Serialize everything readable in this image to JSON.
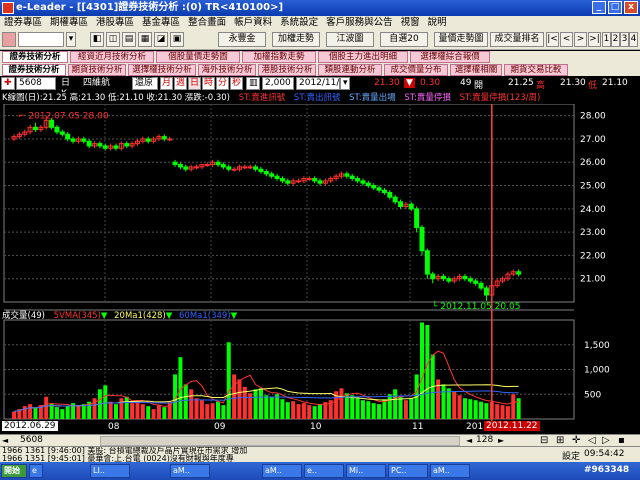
{
  "window": {
    "title": "e-Leader - [[4301]證券技術分析 :(0) TR<410100>]",
    "controls": [
      "_",
      "□",
      "x"
    ]
  },
  "menu": [
    "證券專區",
    "期權專區",
    "港股專區",
    "基金專區",
    "整合畫面",
    "帳戶資料",
    "系統設定",
    "客戶服務與公告",
    "視窗",
    "說明"
  ],
  "toolbar": {
    "buttons": [
      "永豐金",
      "加權走勢",
      "江波圖",
      "自選20",
      "量價走勢圖",
      "成交量排名"
    ],
    "nav": [
      "|<",
      "<",
      ">",
      ">|",
      "1",
      "2",
      "3",
      "4"
    ]
  },
  "tabs_row1": [
    "證券技術分析",
    "經資近月技術分析",
    "個股量價走勢圖",
    "加權指數走勢",
    "個股主力進出明細",
    "選擇權綜合報價"
  ],
  "tabs_row2": [
    "證券技術分析",
    "期貨技術分析",
    "選擇權技術分析",
    "海外技術分析",
    "港股技術分析",
    "類股連動分析",
    "成交價量分布",
    "選擇權相關",
    "期貨交易比較"
  ],
  "chartbar": {
    "symbol": "5608",
    "name": "四維航",
    "period_label": "日K",
    "buttons": [
      "還原",
      "月",
      "週",
      "日",
      "時",
      "分",
      "秒"
    ],
    "count": "2,000",
    "date": "2012/11/29",
    "quote": {
      "open_label": "開",
      "open_value": "21.30",
      "change_value": "0.30",
      "volume_value": "49",
      "high_label": "開",
      "high_value": "21.25",
      "low_label": "高",
      "low_value": "21.30",
      "close_label": "低",
      "close_value": "21.10"
    }
  },
  "infobar": {
    "prices": "K線圖(日):21.25 高:21.30 低:21.10 收:21.30 漲跌:-0.30)",
    "labels": [
      {
        "text": "ST:賣進訊號",
        "color": "#ff3333"
      },
      {
        "text": "ST:賣出訊號",
        "color": "#3366ff"
      },
      {
        "text": "ST:賣量出場",
        "color": "#66aaff"
      },
      {
        "text": "ST:賣量停損",
        "color": "#ff66ff"
      },
      {
        "text": "ST:賣量停損(123/周)",
        "color": "#ff3333"
      }
    ]
  },
  "annotations": {
    "high": "2012.07.05  28.00",
    "low": "2012.11.05  20.05"
  },
  "volume": {
    "label": "成交量(49)",
    "ma": [
      {
        "text": "5VMA(345)",
        "color": "#ff3333"
      },
      {
        "text": "20Ma1(428)",
        "color": "#ffff66"
      },
      {
        "text": "60Ma1(349)",
        "color": "#3366ff"
      }
    ]
  },
  "dates": {
    "start": "2012.06.29",
    "months": [
      "08",
      "09",
      "10",
      "11",
      "201"
    ],
    "cursor": "2012.11.22"
  },
  "scroll": {
    "symbol": "5608",
    "zoom": "128"
  },
  "status": {
    "quote_lines": [
      "1966 1361 [9:46:00] 美股: 台積電總裁及戶晶片實現在市需求 增加",
      "1966 1351 [9:45:01] 豪華會:上.台電 (0024)沒有財報與年度專"
    ],
    "setting": "設定",
    "time": "09:54:42",
    "code": "#963348"
  },
  "taskbar": [
    "開始",
    "e",
    "LI..",
    "aM..",
    "aM..",
    "e..",
    "Mi..",
    "PC..",
    "aM.."
  ],
  "chart_data": {
    "type": "candlestick",
    "yticks": [
      21.0,
      22.0,
      23.0,
      24.0,
      25.0,
      26.0,
      27.0,
      28.0
    ],
    "volume_ticks": [
      500,
      1000,
      1500
    ],
    "colors": {
      "up": "#ff3030",
      "down": "#00ff00",
      "grid": "#808080"
    },
    "ohlc": [
      [
        27.0,
        27.2,
        26.9,
        27.1
      ],
      [
        27.1,
        27.3,
        27.0,
        27.2
      ],
      [
        27.2,
        27.4,
        27.1,
        27.3
      ],
      [
        27.3,
        27.6,
        27.2,
        27.5
      ],
      [
        27.5,
        27.7,
        27.3,
        27.4
      ],
      [
        27.4,
        27.6,
        27.3,
        27.5
      ],
      [
        27.5,
        28.0,
        27.4,
        27.8
      ],
      [
        27.8,
        27.9,
        27.4,
        27.5
      ],
      [
        27.5,
        27.6,
        27.2,
        27.3
      ],
      [
        27.3,
        27.4,
        27.1,
        27.2
      ],
      [
        27.2,
        27.3,
        26.9,
        27.0
      ],
      [
        27.0,
        27.1,
        26.8,
        26.9
      ],
      [
        26.9,
        27.1,
        26.8,
        27.0
      ],
      [
        27.0,
        27.1,
        26.8,
        26.9
      ],
      [
        26.9,
        27.0,
        26.6,
        26.7
      ],
      [
        26.7,
        26.9,
        26.6,
        26.8
      ],
      [
        26.8,
        26.9,
        26.6,
        26.7
      ],
      [
        26.7,
        26.8,
        26.5,
        26.6
      ],
      [
        26.6,
        26.8,
        26.5,
        26.7
      ],
      [
        26.7,
        26.8,
        26.5,
        26.6
      ],
      [
        26.6,
        26.9,
        26.5,
        26.8
      ],
      [
        26.8,
        26.9,
        26.6,
        26.7
      ],
      [
        26.7,
        26.9,
        26.6,
        26.8
      ],
      [
        26.8,
        27.0,
        26.7,
        26.9
      ],
      [
        26.9,
        27.1,
        26.8,
        27.0
      ],
      [
        27.0,
        27.1,
        26.8,
        26.9
      ],
      [
        26.9,
        27.1,
        26.8,
        27.0
      ],
      [
        27.0,
        27.2,
        26.9,
        27.1
      ],
      [
        27.1,
        27.2,
        26.9,
        27.0
      ],
      [
        27.0,
        27.1,
        26.9,
        27.0
      ],
      [
        26.0,
        26.1,
        25.8,
        25.9
      ],
      [
        25.9,
        26.0,
        25.7,
        25.8
      ],
      [
        25.8,
        25.9,
        25.6,
        25.7
      ],
      [
        25.7,
        25.9,
        25.6,
        25.8
      ],
      [
        25.8,
        25.9,
        25.7,
        25.8
      ],
      [
        25.8,
        25.9,
        25.7,
        25.9
      ],
      [
        25.9,
        26.0,
        25.8,
        25.9
      ],
      [
        25.9,
        26.1,
        25.8,
        26.0
      ],
      [
        26.0,
        26.1,
        25.8,
        25.9
      ],
      [
        25.9,
        26.0,
        25.7,
        25.8
      ],
      [
        25.8,
        25.9,
        25.6,
        25.7
      ],
      [
        25.7,
        25.8,
        25.6,
        25.7
      ],
      [
        25.7,
        25.9,
        25.6,
        25.8
      ],
      [
        25.8,
        25.9,
        25.7,
        25.8
      ],
      [
        25.8,
        25.9,
        25.7,
        25.8
      ],
      [
        25.8,
        25.9,
        25.6,
        25.7
      ],
      [
        25.7,
        25.8,
        25.5,
        25.6
      ],
      [
        25.6,
        25.7,
        25.4,
        25.5
      ],
      [
        25.5,
        25.6,
        25.3,
        25.4
      ],
      [
        25.4,
        25.5,
        25.2,
        25.3
      ],
      [
        25.3,
        25.4,
        25.1,
        25.2
      ],
      [
        25.2,
        25.3,
        25.0,
        25.1
      ],
      [
        25.1,
        25.3,
        25.0,
        25.2
      ],
      [
        25.2,
        25.3,
        25.1,
        25.2
      ],
      [
        25.2,
        25.4,
        25.1,
        25.3
      ],
      [
        25.3,
        25.4,
        25.2,
        25.3
      ],
      [
        25.3,
        25.4,
        25.1,
        25.2
      ],
      [
        25.2,
        25.3,
        25.0,
        25.1
      ],
      [
        25.1,
        25.3,
        25.0,
        25.2
      ],
      [
        25.2,
        25.4,
        25.1,
        25.3
      ],
      [
        25.3,
        25.5,
        25.2,
        25.4
      ],
      [
        25.4,
        25.6,
        25.3,
        25.5
      ],
      [
        25.5,
        25.6,
        25.3,
        25.4
      ],
      [
        25.4,
        25.5,
        25.2,
        25.3
      ],
      [
        25.3,
        25.4,
        25.1,
        25.2
      ],
      [
        25.2,
        25.3,
        25.0,
        25.1
      ],
      [
        25.1,
        25.2,
        24.9,
        25.0
      ],
      [
        25.0,
        25.1,
        24.8,
        24.9
      ],
      [
        24.9,
        25.0,
        24.7,
        24.8
      ],
      [
        24.8,
        24.9,
        24.6,
        24.7
      ],
      [
        24.7,
        24.8,
        24.4,
        24.5
      ],
      [
        24.5,
        24.6,
        24.2,
        24.3
      ],
      [
        24.3,
        24.4,
        24.0,
        24.1
      ],
      [
        24.1,
        24.3,
        24.0,
        24.2
      ],
      [
        24.2,
        24.3,
        23.9,
        24.0
      ],
      [
        24.0,
        24.1,
        23.0,
        23.2
      ],
      [
        23.2,
        23.3,
        22.0,
        22.2
      ],
      [
        22.2,
        22.3,
        21.0,
        21.2
      ],
      [
        21.2,
        21.3,
        20.8,
        21.0
      ],
      [
        21.0,
        21.2,
        20.9,
        21.1
      ],
      [
        21.1,
        21.2,
        20.9,
        21.0
      ],
      [
        21.0,
        21.1,
        20.8,
        20.9
      ],
      [
        20.9,
        21.1,
        20.8,
        21.0
      ],
      [
        21.0,
        21.2,
        20.9,
        21.1
      ],
      [
        21.1,
        21.2,
        20.9,
        21.0
      ],
      [
        21.0,
        21.1,
        20.8,
        20.9
      ],
      [
        20.9,
        21.0,
        20.7,
        20.8
      ],
      [
        20.8,
        20.9,
        20.5,
        20.6
      ],
      [
        20.6,
        20.7,
        20.05,
        20.3
      ],
      [
        20.3,
        20.8,
        20.2,
        20.7
      ],
      [
        20.7,
        21.0,
        20.6,
        20.9
      ],
      [
        20.9,
        21.1,
        20.8,
        21.0
      ],
      [
        21.0,
        21.3,
        20.9,
        21.2
      ],
      [
        21.2,
        21.4,
        21.1,
        21.3
      ],
      [
        21.3,
        21.4,
        21.1,
        21.2
      ]
    ],
    "volume": [
      150,
      200,
      260,
      300,
      220,
      280,
      450,
      320,
      240,
      200,
      260,
      320,
      280,
      300,
      350,
      420,
      600,
      680,
      350,
      300,
      420,
      450,
      320,
      380,
      300,
      260,
      200,
      280,
      240,
      340,
      900,
      1250,
      700,
      600,
      420,
      380,
      300,
      320,
      350,
      280,
      1550,
      900,
      800,
      650,
      520,
      600,
      620,
      480,
      440,
      500,
      400,
      340,
      360,
      300,
      320,
      280,
      260,
      300,
      340,
      380,
      560,
      620,
      520,
      480,
      420,
      380,
      360,
      320,
      300,
      400,
      500,
      600,
      450,
      380,
      420,
      900,
      1950,
      1900,
      1300,
      800,
      700,
      620,
      560,
      480,
      420,
      400,
      380,
      350,
      320,
      340,
      300,
      280,
      260,
      500,
      420
    ]
  }
}
